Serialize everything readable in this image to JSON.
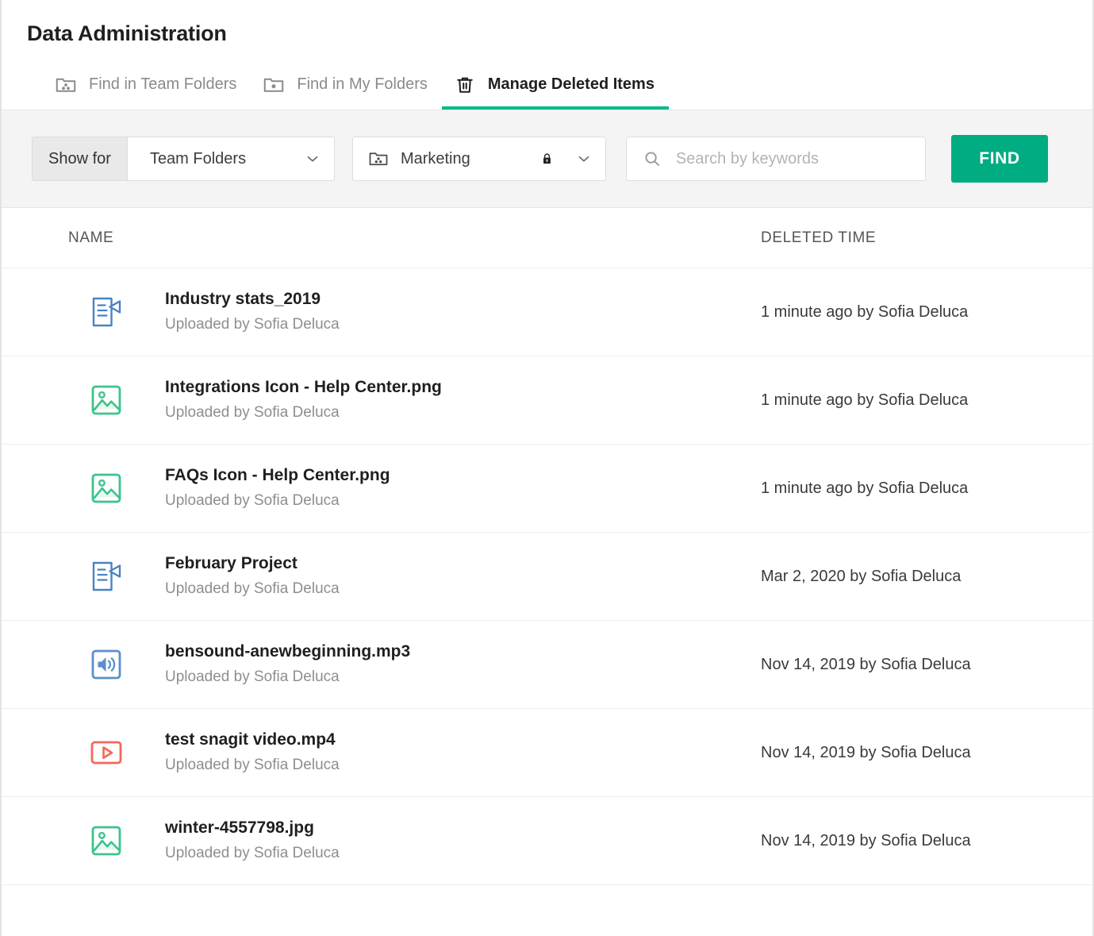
{
  "header": {
    "title": "Data Administration",
    "tabs": [
      {
        "label": "Find in Team Folders",
        "icon": "team-folder-icon",
        "active": false
      },
      {
        "label": "Find in My Folders",
        "icon": "my-folder-icon",
        "active": false
      },
      {
        "label": "Manage Deleted Items",
        "icon": "trash-icon",
        "active": true
      }
    ]
  },
  "filterbar": {
    "show_for_label": "Show for",
    "scope_select": {
      "value": "Team Folders",
      "icon": "chevron-down-icon"
    },
    "folder_select": {
      "value": "Marketing",
      "folder_icon": "team-folder-icon",
      "lock_icon": "lock-icon",
      "chevron_icon": "chevron-down-icon"
    },
    "search": {
      "value": "",
      "placeholder": "Search by keywords",
      "icon": "search-icon"
    },
    "find_button": "FIND"
  },
  "table": {
    "columns": {
      "name": "NAME",
      "deleted_time": "DELETED TIME"
    },
    "rows": [
      {
        "icon": "document-icon",
        "name": "Industry stats_2019",
        "sub": "Uploaded by Sofia Deluca",
        "time": "1 minute ago by Sofia Deluca"
      },
      {
        "icon": "image-icon",
        "name": "Integrations Icon - Help Center.png",
        "sub": "Uploaded by Sofia Deluca",
        "time": "1 minute ago by Sofia Deluca"
      },
      {
        "icon": "image-icon",
        "name": "FAQs Icon - Help Center.png",
        "sub": "Uploaded by Sofia Deluca",
        "time": "1 minute ago by Sofia Deluca"
      },
      {
        "icon": "document-icon",
        "name": "February Project",
        "sub": "Uploaded by Sofia Deluca",
        "time": "Mar 2, 2020 by Sofia Deluca"
      },
      {
        "icon": "audio-icon",
        "name": "bensound-anewbeginning.mp3",
        "sub": "Uploaded by Sofia Deluca",
        "time": "Nov 14, 2019 by Sofia Deluca"
      },
      {
        "icon": "video-icon",
        "name": "test snagit video.mp4",
        "sub": "Uploaded by Sofia Deluca",
        "time": "Nov 14, 2019 by Sofia Deluca"
      },
      {
        "icon": "image-icon",
        "name": "winter-4557798.jpg",
        "sub": "Uploaded by Sofia Deluca",
        "time": "Nov 14, 2019 by Sofia Deluca"
      }
    ]
  },
  "colors": {
    "accent_green": "#00b98b",
    "find_button": "#00ac82",
    "document_icon": "#4a82c4",
    "image_icon": "#4ac48d",
    "audio_icon": "#5b8fc9",
    "video_icon": "#f2685c",
    "filterbar_bg": "#f4f4f4"
  }
}
